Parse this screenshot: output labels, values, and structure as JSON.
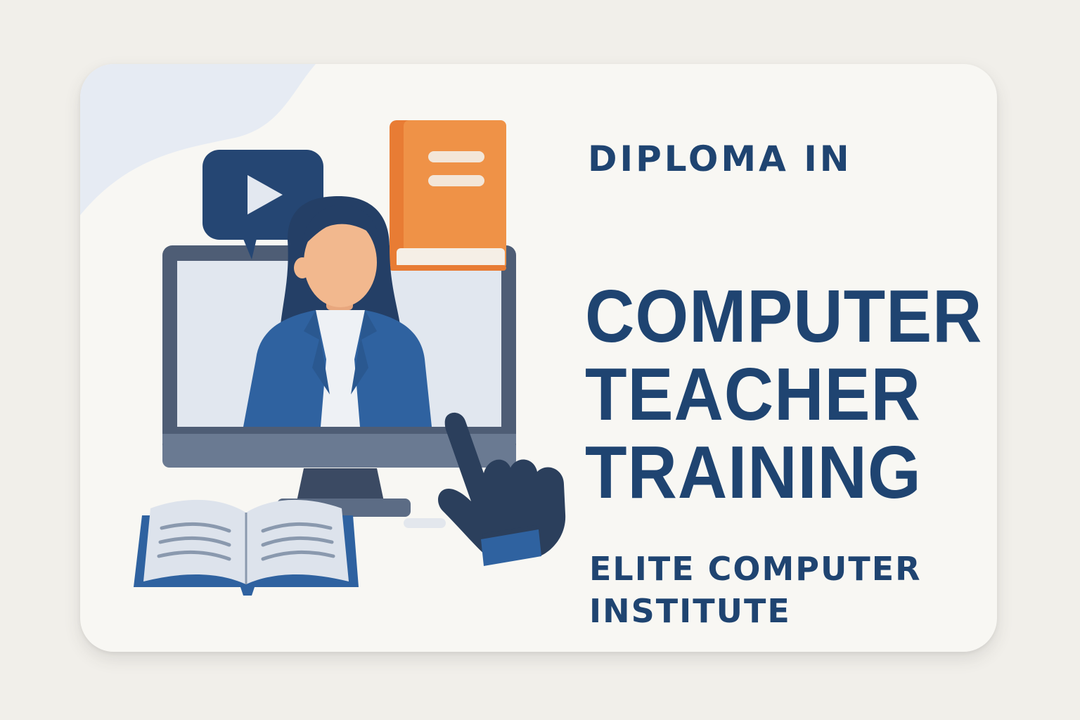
{
  "course": {
    "kicker": "DIPLOMA IN",
    "title_lines": [
      "COMPUTER",
      "TEACHER",
      "TRAINING"
    ],
    "institute_lines": [
      "ELITE COMPUTER",
      "INSTITUTE"
    ]
  },
  "colors": {
    "navy": "#1f4471",
    "blazer_blue": "#2f62a0",
    "book_orange": "#ec8a3d",
    "screen_light": "#e1e7ef",
    "monitor_gray": "#4e5d75",
    "skin": "#f2b88e",
    "card_bg": "#f8f7f3",
    "blob": "#e6ebf3"
  },
  "icons": [
    "play-video-icon",
    "book-icon",
    "teacher-avatar",
    "monitor-icon",
    "pointing-hand-icon",
    "open-book-icon"
  ]
}
